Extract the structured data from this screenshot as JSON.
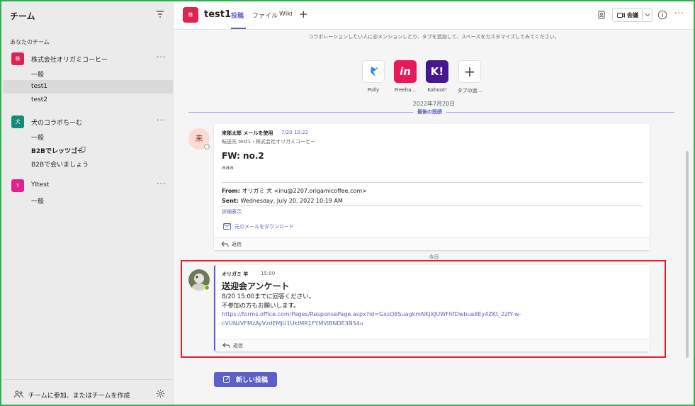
{
  "sidebar": {
    "title": "チーム",
    "section_label": "あなたのチーム",
    "teams": [
      {
        "avatar": "株",
        "avatar_color": "#e0234e",
        "name": "株式会社オリガミコーヒー",
        "channels": [
          {
            "label": "一般"
          },
          {
            "label": "test1"
          },
          {
            "label": "test2"
          }
        ]
      },
      {
        "avatar": "犬",
        "avatar_color": "#168b7a",
        "name": "犬のコラボちーむ",
        "channels": [
          {
            "label": "一般"
          },
          {
            "label": "B2Bでレッツゴー"
          },
          {
            "label": "B2Bで会いましょう"
          }
        ]
      },
      {
        "avatar": "Y",
        "avatar_color": "#e0238b",
        "name": "YItest",
        "channels": [
          {
            "label": "一般"
          }
        ]
      }
    ],
    "more_glyph": "···",
    "join_label": "チームに参加、またはチームを作成"
  },
  "header": {
    "avatar": "株",
    "title": "test1",
    "tabs": [
      {
        "label": "投稿"
      },
      {
        "label": "ファイル"
      },
      {
        "label": "Wiki"
      }
    ],
    "add_tab": "+",
    "meet_label": "会議",
    "more_glyph": "···"
  },
  "main": {
    "intro": "コラボレーションしたい人に@メンションしたり、タブを追加して、スペースをカスタマイズしてみてください。",
    "apps": [
      {
        "label": "Polly",
        "color": "#ffffff"
      },
      {
        "label": "Freeha...",
        "color": "#e8195b"
      },
      {
        "label": "Kahoot!",
        "color": "#46178f"
      },
      {
        "label": "タブの追...",
        "color": "#ffffff"
      }
    ],
    "date_divider": "2022年7月20日",
    "last_read": "最後の既読",
    "post1": {
      "avatar": "来",
      "author": "来部太郎 メールを使用",
      "time": "7/20 10:22",
      "forwarded": "転送先 test1・株式会社オリガミコーヒー",
      "subject": "FW: no.2",
      "body": "aaa",
      "from_label": "From:",
      "from_value": "オリガミ 犬 <inu@2207.origamicoffee.com>",
      "sent_label": "Sent:",
      "sent_value": "Wednesday, July 20, 2022 10:19 AM",
      "details": "詳細表示",
      "download": "元のメールをダウンロード",
      "reply": "返信"
    },
    "today": "今日",
    "post2": {
      "author": "オリガミ 羊",
      "time": "15:00",
      "title": "送迎会アンケート",
      "line1": "8/20 15:00までに回答ください。",
      "line2": "不参加の方もお願いします。",
      "link_line1": "https://forms.office.com/Pages/ResponsePage.aspx?id=GxsO8SuagkmNKjXJUWFhfDwbua8Ey4ZKt_2zfY-w-",
      "link_line2": "cVUNzVFMzAyVzdEMjU1UklMR1FYMVlBNDE3NS4u",
      "reply": "返信"
    },
    "new_post": "新しい投稿"
  },
  "colors": {
    "accent": "#5b5fc7",
    "highlight_border": "#e0202a",
    "frame_border": "#2fb24c"
  }
}
